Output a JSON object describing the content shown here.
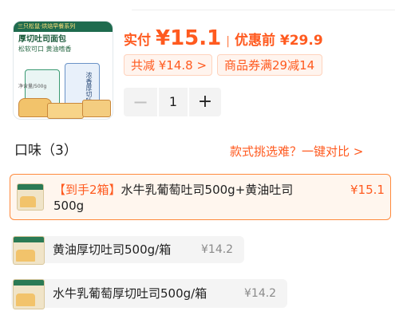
{
  "product_image": {
    "brand_line": "三只松鼠·烘焙早餐系列",
    "title": "厚切吐司面包",
    "subtitle": "松软可口 黄油嗜香",
    "weight": "净含量/500g",
    "bag_text": "浓香厚切吐司"
  },
  "price": {
    "actual_label": "实付",
    "actual_value": "¥15.1",
    "separator": "|",
    "original": "优惠前 ¥29.9",
    "total_discount": "共减 ¥14.8 >",
    "coupon": "商品券满29减14"
  },
  "quantity": {
    "minus": "−",
    "value": "1",
    "plus": "+"
  },
  "flavors": {
    "title": "口味（3）",
    "compare_link": "款式挑选难？一键对比 >",
    "options": [
      {
        "highlight": "【到手2箱】",
        "name": "水牛乳葡萄吐司500g+黄油吐司500g",
        "price": "¥15.1",
        "selected": true
      },
      {
        "name": "黄油厚切吐司500g/箱",
        "price": "¥14.2",
        "selected": false
      },
      {
        "name": "水牛乳葡萄厚切吐司500g/箱",
        "price": "¥14.2",
        "selected": false
      }
    ]
  },
  "colors": {
    "accent": "#ff5a1f",
    "selected_border": "#ff8a3d",
    "selected_bg": "#fff6ee",
    "option_bg": "#f4f4f4"
  }
}
